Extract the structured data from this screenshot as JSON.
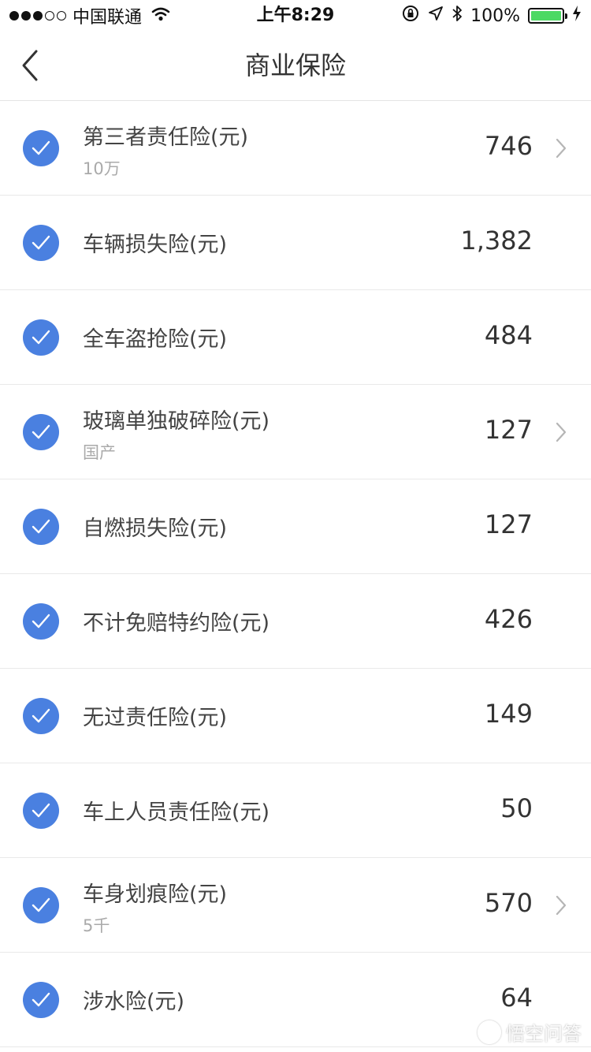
{
  "status_bar": {
    "carrier": "中国联通",
    "time": "上午8:29",
    "battery": "100%",
    "signal_bars_filled": 3,
    "signal_bars_total": 5
  },
  "nav": {
    "title": "商业保险",
    "back_icon": "chevron-left-icon"
  },
  "items": [
    {
      "name": "第三者责任险(元)",
      "sub": "10万",
      "amount": "746",
      "has_chevron": true,
      "checked": true
    },
    {
      "name": "车辆损失险(元)",
      "sub": "",
      "amount": "1,382",
      "has_chevron": false,
      "checked": true
    },
    {
      "name": "全车盗抢险(元)",
      "sub": "",
      "amount": "484",
      "has_chevron": false,
      "checked": true
    },
    {
      "name": "玻璃单独破碎险(元)",
      "sub": "国产",
      "amount": "127",
      "has_chevron": true,
      "checked": true
    },
    {
      "name": "自燃损失险(元)",
      "sub": "",
      "amount": "127",
      "has_chevron": false,
      "checked": true
    },
    {
      "name": "不计免赔特约险(元)",
      "sub": "",
      "amount": "426",
      "has_chevron": false,
      "checked": true
    },
    {
      "name": "无过责任险(元)",
      "sub": "",
      "amount": "149",
      "has_chevron": false,
      "checked": true
    },
    {
      "name": "车上人员责任险(元)",
      "sub": "",
      "amount": "50",
      "has_chevron": false,
      "checked": true
    },
    {
      "name": "车身划痕险(元)",
      "sub": "5千",
      "amount": "570",
      "has_chevron": true,
      "checked": true
    },
    {
      "name": "涉水险(元)",
      "sub": "",
      "amount": "64",
      "has_chevron": false,
      "checked": true
    }
  ],
  "watermark": {
    "text": "悟空问答"
  },
  "colors": {
    "accent": "#4a80e0",
    "text": "#444444",
    "subtext": "#aaaaaa",
    "divider": "#e9e9e9",
    "battery": "#4cd964"
  }
}
